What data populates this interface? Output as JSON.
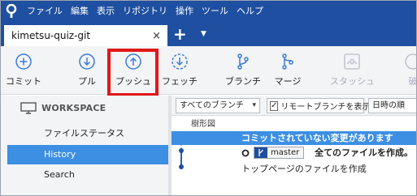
{
  "menubar": {
    "items": [
      "ファイル",
      "編集",
      "表示",
      "リポジトリ",
      "操作",
      "ツール",
      "ヘルプ"
    ]
  },
  "tab": {
    "title": "kimetsu-quiz-git",
    "close": "×",
    "new": "+",
    "dropdown": "▼"
  },
  "toolbar": {
    "commit": "コミット",
    "pull": "プル",
    "push": "プッシュ",
    "fetch": "フェッチ",
    "branch": "ブランチ",
    "merge": "マージ",
    "stash": "スタッシュ",
    "discard": "破"
  },
  "sidebar": {
    "workspace": "WORKSPACE",
    "items": [
      {
        "label": "ファイルステータス"
      },
      {
        "label": "History"
      },
      {
        "label": "Search"
      }
    ]
  },
  "filters": {
    "branch_select": "すべてのブランチ",
    "remote_toggle": "リモートブランチを表示",
    "remote_checked": "✓",
    "sort_select": "日時の順"
  },
  "history": {
    "graph_header": "樹形図",
    "rows": [
      {
        "message": "コミットされていない変更があります"
      },
      {
        "branch": "master",
        "message": "全てのファイルを作成。"
      },
      {
        "message": "トップページのファイルを作成"
      }
    ]
  },
  "colors": {
    "menubar": "#1f4fa0",
    "selection": "#3d8fe3",
    "highlight": "#e01818",
    "icon": "#3a7bd5"
  }
}
